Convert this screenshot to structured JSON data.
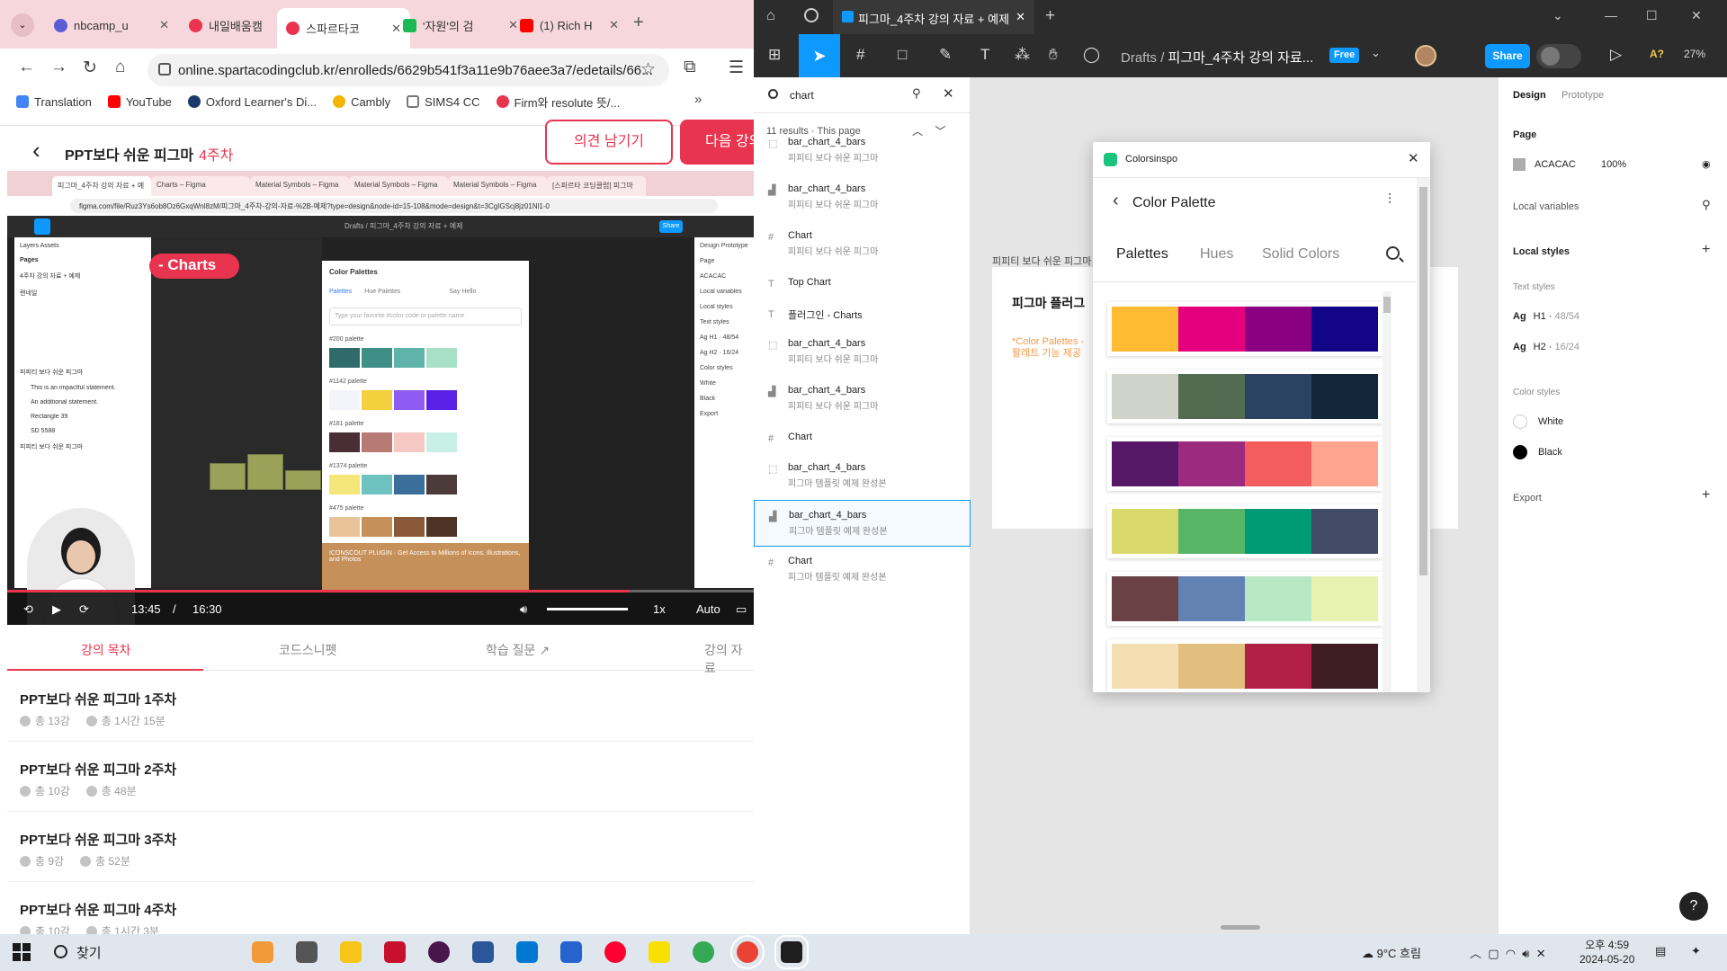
{
  "browser": {
    "tabs": [
      {
        "label": "nbcamp_u",
        "color": "#5b5bd6"
      },
      {
        "label": "내일배움캠",
        "color": "#e8344e"
      },
      {
        "label": "스파르타코",
        "color": "#e8344e"
      },
      {
        "label": "'자원'의 검",
        "color": "#1db954"
      },
      {
        "label": "(1) Rich H",
        "color": "#ff0000"
      }
    ],
    "url": "online.spartacodingclub.kr/enrolleds/6629b541f3a11e9b76aee3a7/edetails/66...",
    "bookmarks": [
      {
        "label": "Translation",
        "color": "#4285f4"
      },
      {
        "label": "YouTube",
        "color": "#ff0000"
      },
      {
        "label": "Oxford Learner's Di...",
        "color": "#1b3a6b"
      },
      {
        "label": "Cambly",
        "color": "#f5b400"
      },
      {
        "label": "SIMS4 CC",
        "color": "#777777"
      },
      {
        "label": "Firm와 resolute 뜻/...",
        "color": "#e8344e"
      }
    ]
  },
  "course": {
    "title": "PPT보다 쉬운 피그마",
    "week": "4주차",
    "opinion_button": "의견 남기기",
    "next_button": "다음 강의"
  },
  "video": {
    "inner_tabs": [
      "피그마_4주차 강의 자료 + 예",
      "Charts – Figma",
      "Material Symbols – Figma",
      "Material Symbols – Figma",
      "Material Symbols – Figma",
      "[스파르타 코딩클럽] 피그마"
    ],
    "inner_url": "figma.com/file/Ruz3Ys6ob8Oz6GxqWnl8zM/피그마_4주차-강의-자료-%2B-예제?type=design&node-id=15-108&mode=design&t=3CgIGScj8jz01Nl1-0",
    "inner_drafts": "Drafts / 피그마_4주차 강의 자료 + 예제",
    "inner_share": "Share",
    "charts_label": "- Charts",
    "left_panel": [
      "Layers  Assets",
      "Pages",
      "4주차 강의 자료 + 예제",
      "랜네일",
      "피피티 보다 쉬운 피그마",
      "This is an impactful statement.",
      "An additional statement.",
      "Rectangle 39",
      "SD 5588",
      "피피티 보다 쉬운 피그마"
    ],
    "plugin_title": "Color Palettes",
    "plugin_tabs": [
      "Palettes",
      "Hue Palettes",
      "Say Hello"
    ],
    "plugin_input": "Type your favorite #color code or palette name",
    "plugin_palettes": [
      {
        "name": "#200 palette",
        "colors": [
          "#2f6b6b",
          "#3f8f86",
          "#5fb3a8",
          "#a8e0c6"
        ]
      },
      {
        "name": "#1142 palette",
        "colors": [
          "#f4f4fb",
          "#f4d03f",
          "#8e5cf5",
          "#5b21e6"
        ]
      },
      {
        "name": "#181 palette",
        "colors": [
          "#4a2e35",
          "#b87a75",
          "#f6c8c3",
          "#c8f0e6"
        ]
      },
      {
        "name": "#1374 palette",
        "colors": [
          "#f5e67a",
          "#6ec3c1",
          "#3a6e9b",
          "#4d3a3a"
        ]
      },
      {
        "name": "#475 palette",
        "colors": [
          "#e9c39a",
          "#c6905a",
          "#8a5a38",
          "#4d3326"
        ]
      }
    ],
    "plugin_banner": "ICONSCOUT PLUGIN · Get Access to Millions of Icons, Illustrations, and Photos",
    "right_panel": [
      "Design  Prototype",
      "Page",
      "ACACAC",
      "Local variables",
      "Local styles",
      "Text styles",
      "Ag  H1 · 48/54",
      "Ag  H2 · 16/24",
      "Color styles",
      "White",
      "Black",
      "Export"
    ],
    "time_current": "13:45",
    "time_sep": "/",
    "time_total": "16:30",
    "progress": 0.834,
    "speed": "1x",
    "quality": "Auto"
  },
  "course_tabs": [
    "강의 목차",
    "코드스니펫",
    "학습 질문",
    "강의 자료"
  ],
  "lessons": [
    {
      "title": "PPT보다 쉬운 피그마 1주차",
      "count": "총 13강",
      "duration": "총 1시간 15분"
    },
    {
      "title": "PPT보다 쉬운 피그마 2주차",
      "count": "총 10강",
      "duration": "총 48분"
    },
    {
      "title": "PPT보다 쉬운 피그마 3주차",
      "count": "총 9강",
      "duration": "총 52분"
    },
    {
      "title": "PPT보다 쉬운 피그마 4주차",
      "count": "총 10강",
      "duration": "총 1시간 3분"
    }
  ],
  "figma": {
    "file_tab": "피그마_4주차 강의 자료 + 예제",
    "breadcrumb_root": "Drafts",
    "breadcrumb_sep": "/",
    "breadcrumb_file": "피그마_4주차 강의 자료...",
    "plan_badge": "Free",
    "share_label": "Share",
    "ai_label": "A?",
    "zoom": "27%",
    "search": {
      "query": "chart",
      "results_meta": "11 results · This page",
      "results": [
        {
          "name": "bar_chart_4_bars",
          "page": "피피티 보다 쉬운 피그마",
          "icon": "frame-dashed-icon"
        },
        {
          "name": "bar_chart_4_bars",
          "page": "피피티 보다 쉬운 피그마",
          "icon": "bar-chart-icon"
        },
        {
          "name": "Chart",
          "page": "피피티 보다 쉬운 피그마",
          "icon": "frame-icon"
        },
        {
          "name": "Top Chart",
          "page": "",
          "icon": "text-icon"
        },
        {
          "name": "플러그인 - Charts",
          "page": "",
          "icon": "text-icon"
        },
        {
          "name": "bar_chart_4_bars",
          "page": "피피티 보다 쉬운 피그마",
          "icon": "frame-dashed-icon"
        },
        {
          "name": "bar_chart_4_bars",
          "page": "피피티 보다 쉬운 피그마",
          "icon": "bar-chart-icon"
        },
        {
          "name": "Chart",
          "page": "",
          "icon": "frame-icon"
        },
        {
          "name": "bar_chart_4_bars",
          "page": "피그마 템플릿 예제 완성본",
          "icon": "frame-dashed-icon"
        },
        {
          "name": "bar_chart_4_bars",
          "page": "피그마 템플릿 예제 완성본",
          "icon": "bar-chart-icon"
        },
        {
          "name": "Chart",
          "page": "피그마 템플릿 예제 완성본",
          "icon": "frame-icon"
        }
      ]
    },
    "canvas": {
      "frame_label": "피피티 보다 쉬운 피그마",
      "frame_heading": "피그마 플러그",
      "frame_sub": "*Color Palettes - 팔레트 기능 제공"
    },
    "plugin": {
      "name": "Colorsinspo",
      "title": "Color Palette",
      "tabs": [
        "Palettes",
        "Hues",
        "Solid Colors"
      ],
      "palettes": [
        [
          "#ffbb33",
          "#e5007e",
          "#8a0080",
          "#120587"
        ],
        [
          "#d0d3c9",
          "#536b51",
          "#2b4260",
          "#14263a"
        ],
        [
          "#561766",
          "#9c2b7f",
          "#f45d5d",
          "#ffa48e"
        ],
        [
          "#d9d96b",
          "#58b567",
          "#009a74",
          "#414b66"
        ],
        [
          "#6a4245",
          "#6282b3",
          "#b8e7c3",
          "#e7f1b0"
        ],
        [
          "#f3dfb2",
          "#e2bf7f",
          "#b21f47",
          "#3f1c22"
        ]
      ]
    },
    "design": {
      "tabs": [
        "Design",
        "Prototype"
      ],
      "page_label": "Page",
      "page_color": "ACACAC",
      "page_opacity": "100%",
      "local_variables": "Local variables",
      "local_styles": "Local styles",
      "text_styles_label": "Text styles",
      "text_styles": [
        {
          "name": "H1",
          "spec": "48/54"
        },
        {
          "name": "H2",
          "spec": "16/24"
        }
      ],
      "color_styles_label": "Color styles",
      "color_styles": [
        {
          "name": "White",
          "color": "#ffffff"
        },
        {
          "name": "Black",
          "color": "#000000"
        }
      ],
      "export_label": "Export",
      "help": "?"
    }
  },
  "taskbar": {
    "search": "찾기",
    "weather": "9°C 흐림",
    "time": "오후 4:59",
    "date": "2024-05-20"
  }
}
